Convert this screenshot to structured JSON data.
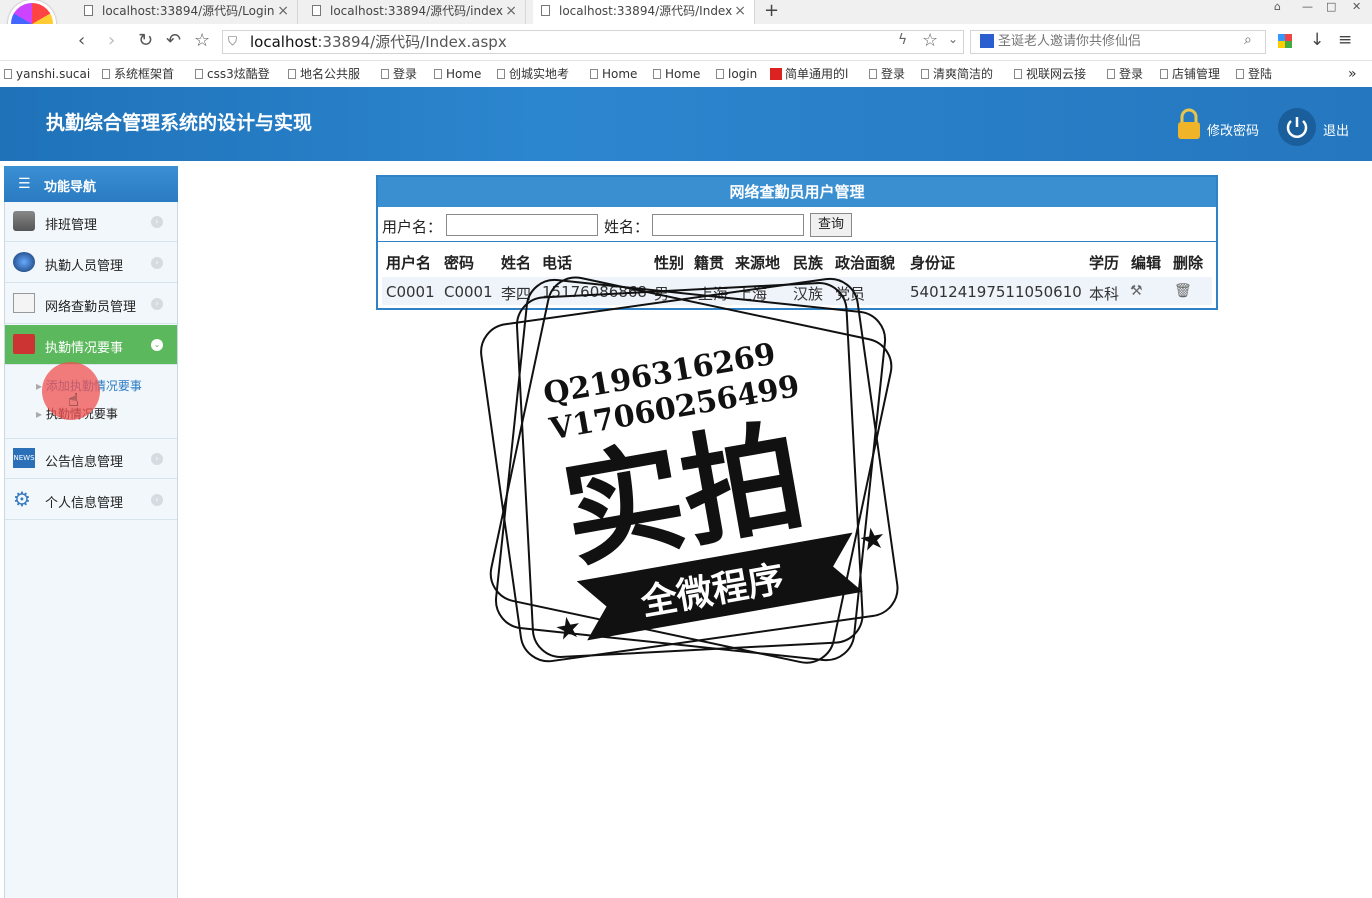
{
  "browser": {
    "tabs": [
      {
        "title": "localhost:33894/源代码/Login",
        "active": false
      },
      {
        "title": "localhost:33894/源代码/index",
        "active": false
      },
      {
        "title": "localhost:33894/源代码/Index",
        "active": true
      }
    ],
    "url_host": "localhost",
    "url_rest": ":33894/源代码/Index.aspx",
    "search_text": "圣诞老人邀请你共修仙侣",
    "bookmarks": [
      "yanshi.sucai",
      "系统框架首",
      "css3炫酷登",
      "地名公共服",
      "登录",
      "Home",
      "创城实地考",
      "Home",
      "Home",
      "login",
      "简单通用的l",
      "登录",
      "清爽简洁的",
      "视联网云接",
      "登录",
      "店铺管理",
      "登陆"
    ],
    "bookmarks_more": "»"
  },
  "header": {
    "title": "执勤综合管理系统的设计与实现",
    "change_password": "修改密码",
    "logout": "退出"
  },
  "sidebar": {
    "heading": "功能导航",
    "items": [
      {
        "label": "排班管理",
        "icon": "printer-icon"
      },
      {
        "label": "执勤人员管理",
        "icon": "globe-icon"
      },
      {
        "label": "网络查勤员管理",
        "icon": "mail-icon"
      },
      {
        "label": "执勤情况要事",
        "icon": "pdf-icon"
      },
      {
        "label": "公告信息管理",
        "icon": "news-icon"
      },
      {
        "label": "个人信息管理",
        "icon": "settings-icon"
      }
    ],
    "subitems": [
      "添加执勤情况要事",
      "执勤情况要事"
    ]
  },
  "main": {
    "title": "网络查勤员用户管理",
    "filters": {
      "username_label": "用户名：",
      "name_label": "姓名：",
      "query_button": "查询"
    },
    "columns": [
      "用户名",
      "密码",
      "姓名",
      "电话",
      "性别",
      "籍贯",
      "来源地",
      "民族",
      "政治面貌",
      "身份证",
      "学历",
      "编辑",
      "删除"
    ],
    "rows": [
      [
        "C0001",
        "C0001",
        "李四",
        "15176086868",
        "男",
        "上海",
        "上海",
        "汉族",
        "党员",
        "540124197511050610",
        "本科"
      ]
    ]
  },
  "watermark": {
    "line1": "Q2196316269",
    "line2": "V17060256499",
    "big": "实拍",
    "banner": "全微程序"
  },
  "colors": {
    "header": "#2a7fc8",
    "active_item": "#5cb85c",
    "table_border": "#2e82c5"
  }
}
